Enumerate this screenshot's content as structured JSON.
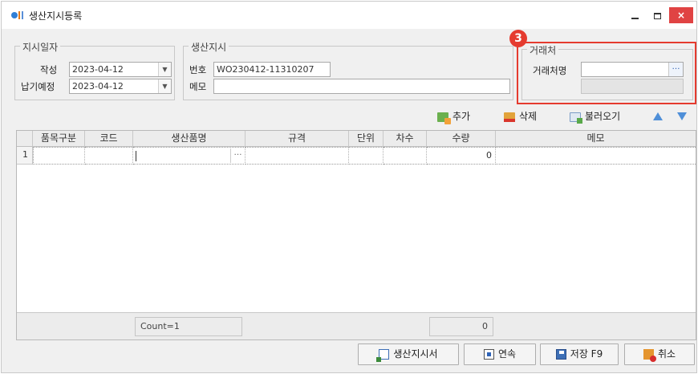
{
  "window": {
    "title": "생산지시등록",
    "close_glyph": "×"
  },
  "order_dates": {
    "group_title": "지시일자",
    "created_label": "작성",
    "created_value": "2023-04-12",
    "due_label": "납기예정",
    "due_value": "2023-04-12"
  },
  "production_order": {
    "group_title": "생산지시",
    "number_label": "번호",
    "number_value": "WO230412-11310207",
    "memo_label": "메모",
    "memo_value": ""
  },
  "client": {
    "badge": "3",
    "group_title": "거래처",
    "name_label": "거래처명",
    "name_value": "",
    "code_value": ""
  },
  "toolbar": {
    "add_label": "추가",
    "delete_label": "삭제",
    "load_label": "불러오기"
  },
  "grid": {
    "columns": [
      "품목구분",
      "코드",
      "생산품명",
      "규격",
      "단위",
      "차수",
      "수량",
      "메모"
    ],
    "rows": [
      {
        "row_no": "1",
        "category": "",
        "code": "",
        "product_name": "",
        "spec": "",
        "unit": "",
        "order_no": "",
        "quantity": "0",
        "memo": ""
      }
    ],
    "footer_count": "Count=1",
    "footer_quantity_total": "0"
  },
  "buttons": {
    "order_sheet": "생산지시서",
    "continuous": "연속",
    "save": "저장 F9",
    "cancel": "취소"
  },
  "colors": {
    "highlight": "#e53b2f",
    "close_button": "#e04343",
    "arrow": "#4f8fd8"
  },
  "icons": [
    "app-icon",
    "dropdown-arrow-icon",
    "ellipsis-icon",
    "add-icon",
    "delete-icon",
    "load-icon",
    "arrow-up-icon",
    "arrow-down-icon",
    "document-icon",
    "continue-icon",
    "save-icon",
    "cancel-icon"
  ]
}
